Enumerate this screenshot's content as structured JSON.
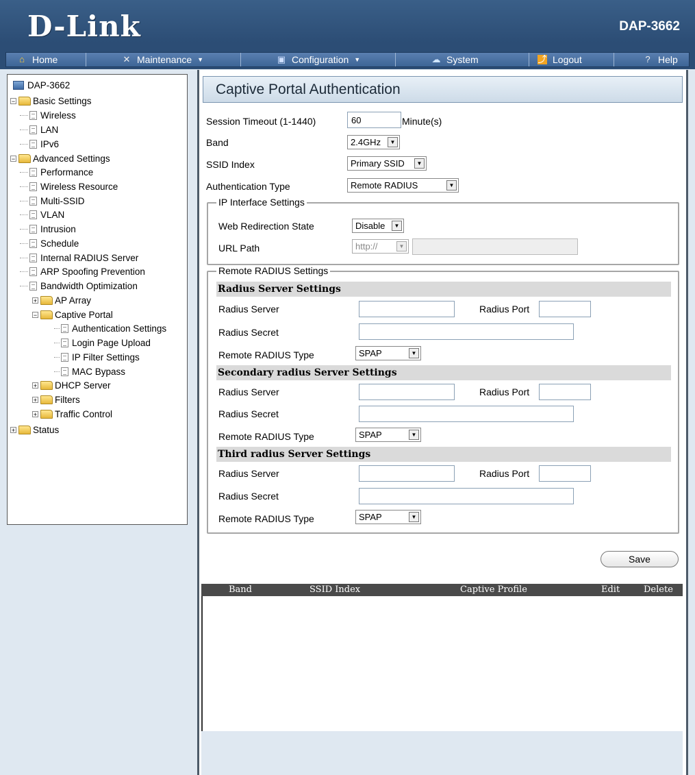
{
  "header": {
    "logo": "D-Link",
    "model": "DAP-3662"
  },
  "menu": [
    {
      "label": "Home",
      "icon": "home-icon"
    },
    {
      "label": "Maintenance",
      "icon": "tools-icon",
      "dropdown": true
    },
    {
      "label": "Configuration",
      "icon": "save-disk-icon",
      "dropdown": true
    },
    {
      "label": "System",
      "icon": "system-icon"
    },
    {
      "label": "Logout",
      "icon": "logout-icon"
    },
    {
      "label": "Help",
      "icon": "help-icon"
    }
  ],
  "sidebar": {
    "root": "DAP-3662",
    "basic_settings": "Basic Settings",
    "basic_items": [
      "Wireless",
      "LAN",
      "IPv6"
    ],
    "advanced_settings": "Advanced Settings",
    "advanced_items": [
      "Performance",
      "Wireless Resource",
      "Multi-SSID",
      "VLAN",
      "Intrusion",
      "Schedule",
      "Internal RADIUS Server",
      "ARP Spoofing Prevention",
      "Bandwidth Optimization"
    ],
    "ap_array": "AP Array",
    "captive_portal": "Captive Portal",
    "captive_items": [
      "Authentication Settings",
      "Login Page Upload",
      "IP Filter Settings",
      "MAC Bypass"
    ],
    "dhcp_server": "DHCP Server",
    "filters": "Filters",
    "traffic_control": "Traffic Control",
    "status": "Status"
  },
  "main": {
    "title": "Captive Portal Authentication",
    "session_timeout_label": "Session Timeout (1-1440)",
    "session_timeout_value": "60",
    "session_timeout_unit": "Minute(s)",
    "band_label": "Band",
    "band_value": "2.4GHz",
    "ssid_index_label": "SSID Index",
    "ssid_index_value": "Primary SSID",
    "auth_type_label": "Authentication Type",
    "auth_type_value": "Remote RADIUS",
    "ip_interface": {
      "legend": "IP Interface Settings",
      "web_redirection_label": "Web Redirection State",
      "web_redirection_value": "Disable",
      "url_path_label": "URL Path",
      "url_path_scheme": "http://",
      "url_path_value": ""
    },
    "remote_radius": {
      "legend": "Remote RADIUS Settings",
      "sections": [
        {
          "title": "Radius Server Settings",
          "server_label": "Radius Server",
          "port_label": "Radius Port",
          "secret_label": "Radius Secret",
          "type_label": "Remote RADIUS Type",
          "type_value": "SPAP"
        },
        {
          "title": "Secondary radius Server Settings",
          "server_label": "Radius Server",
          "port_label": "Radius Port",
          "secret_label": "Radius Secret",
          "type_label": "Remote RADIUS Type",
          "type_value": "SPAP"
        },
        {
          "title": "Third radius Server Settings",
          "server_label": "Radius Server",
          "port_label": "Radius Port",
          "secret_label": "Radius Secret",
          "type_label": "Remote RADIUS Type",
          "type_value": "SPAP"
        }
      ]
    },
    "save_label": "Save",
    "table": {
      "columns": [
        "Band",
        "SSID Index",
        "Captive Profile",
        "Edit",
        "Delete"
      ],
      "rows": []
    }
  }
}
